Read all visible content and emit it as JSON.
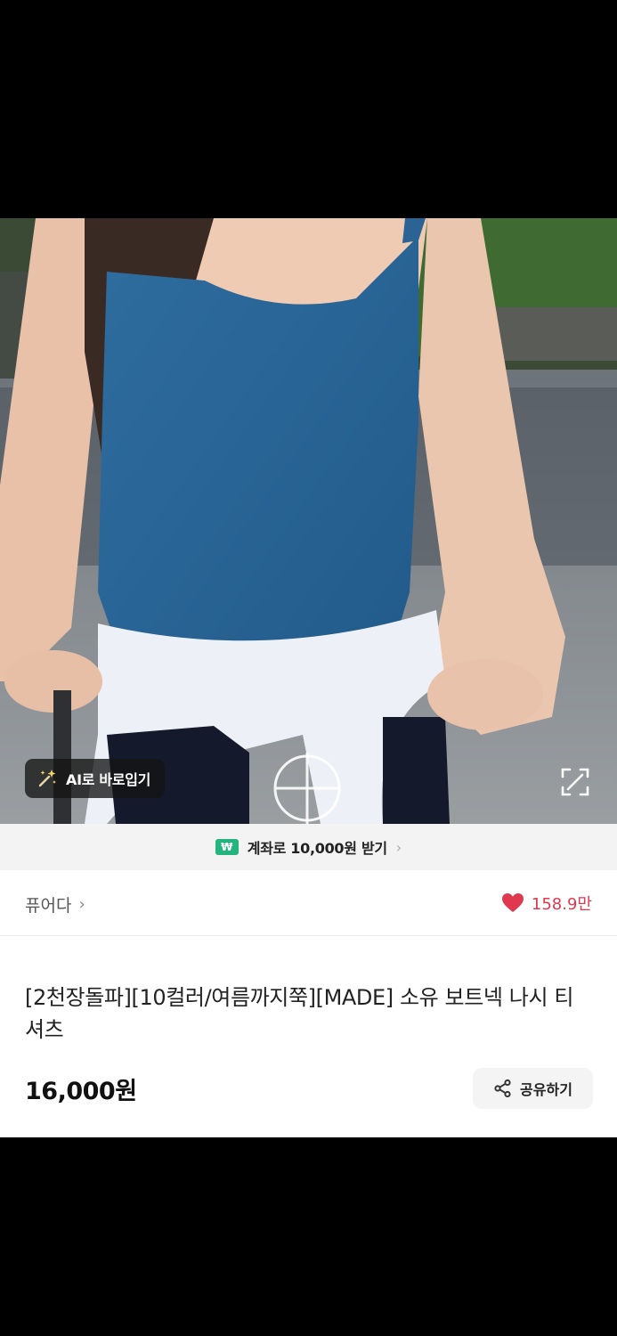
{
  "product_image": {
    "ai_try_on_label": "AI로 바로입기",
    "ai_icon": "magic-wand-sparkle-icon",
    "expand_icon": "expand-icon"
  },
  "promo": {
    "icon": "won-icon",
    "won_symbol": "₩",
    "text": "계좌로 10,000원 받기",
    "chevron": "›"
  },
  "shop": {
    "name": "퓨어다",
    "chevron": "›",
    "likes": "158.9만",
    "heart_color": "#e0384f"
  },
  "product": {
    "title": "[2천장돌파][10컬러/여름까지쭉][MADE] 소유 보트넥 나시 티셔츠",
    "price": "16,000원"
  },
  "share": {
    "label": "공유하기",
    "icon": "share-icon"
  }
}
